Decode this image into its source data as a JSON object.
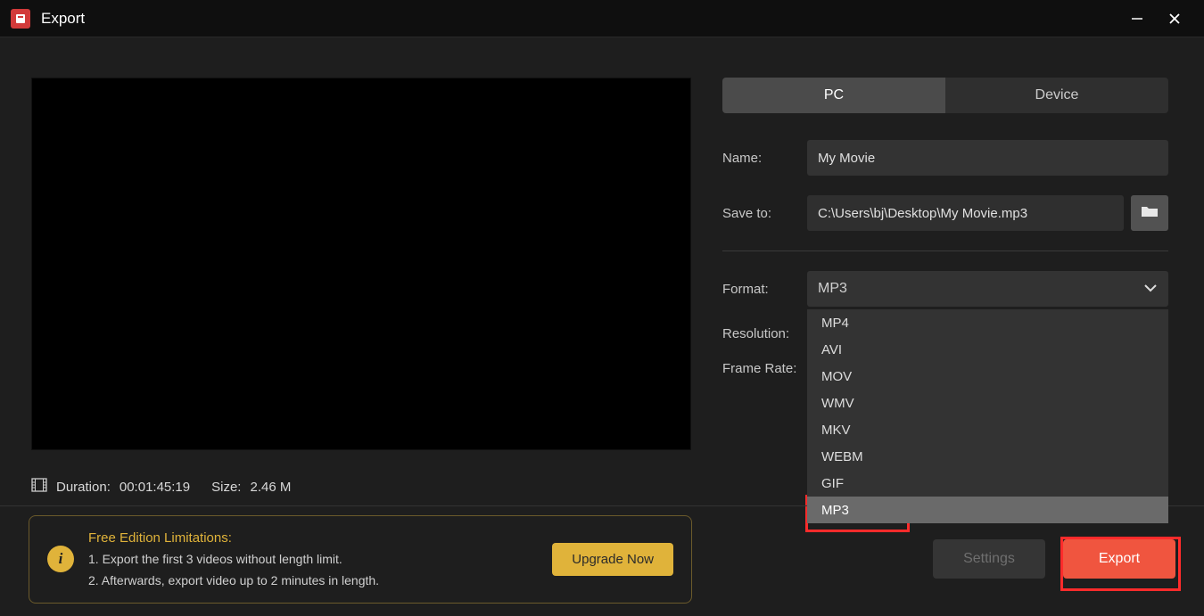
{
  "titlebar": {
    "title": "Export"
  },
  "tabs": {
    "pc": "PC",
    "device": "Device"
  },
  "fields": {
    "name_label": "Name:",
    "name_value": "My Movie",
    "saveto_label": "Save to:",
    "saveto_value": "C:\\Users\\bj\\Desktop\\My Movie.mp3",
    "format_label": "Format:",
    "format_value": "MP3",
    "resolution_label": "Resolution:",
    "framerate_label": "Frame Rate:"
  },
  "format_options": [
    "MP4",
    "AVI",
    "MOV",
    "WMV",
    "MKV",
    "WEBM",
    "GIF",
    "MP3"
  ],
  "format_selected": "MP3",
  "meta": {
    "duration_label": "Duration:",
    "duration_value": "00:01:45:19",
    "size_label": "Size:",
    "size_value": "2.46 M"
  },
  "limits": {
    "title": "Free Edition Limitations:",
    "line1": "1. Export the first 3 videos without length limit.",
    "line2": "2. Afterwards, export video up to 2 minutes in length.",
    "upgrade": "Upgrade Now"
  },
  "footer": {
    "settings": "Settings",
    "export": "Export"
  }
}
